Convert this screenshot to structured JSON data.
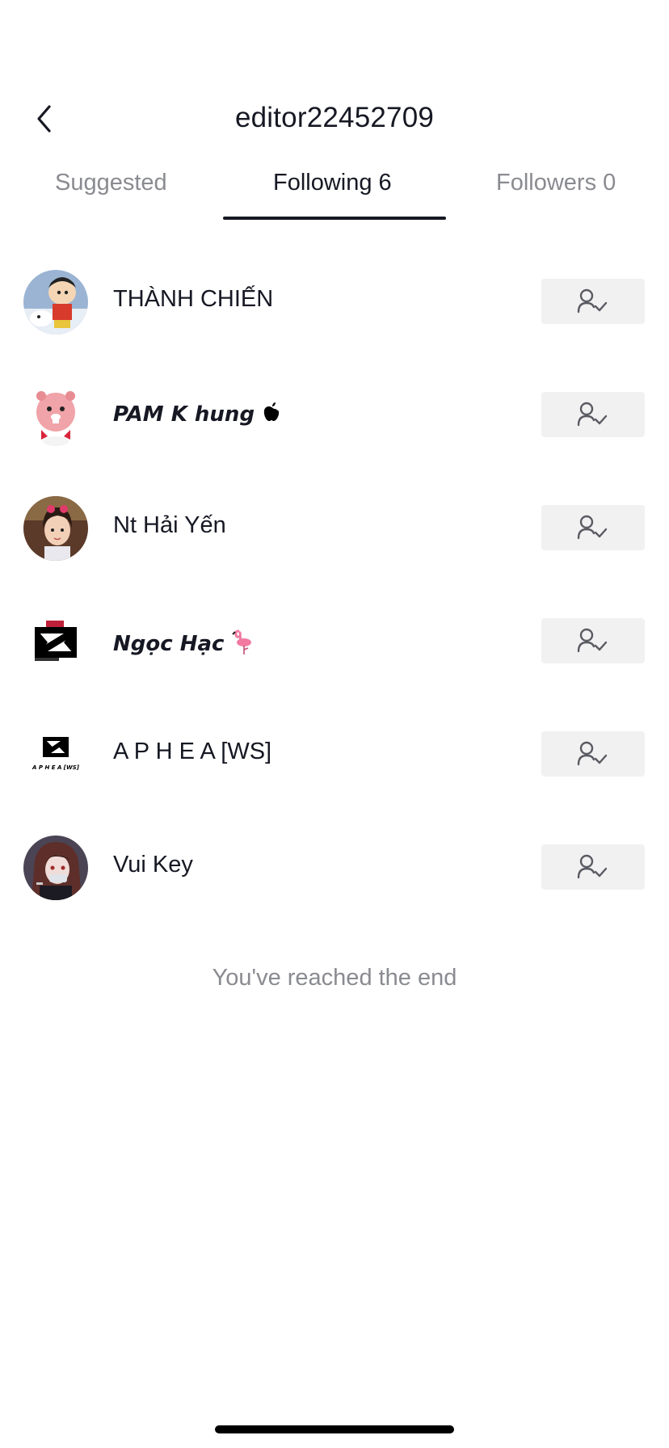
{
  "header": {
    "title": "editor22452709",
    "back_icon": "chevron-left-icon"
  },
  "tabs": [
    {
      "label": "Suggested",
      "active": false
    },
    {
      "label": "Following 6",
      "active": true
    },
    {
      "label": "Followers 0",
      "active": false
    }
  ],
  "following": [
    {
      "name": "THÀNH CHIẾN",
      "avatar": "cartoon-boy-avatar",
      "status_icon": "following-user-check-icon"
    },
    {
      "name": "PAM K hung",
      "badge_icon": "apple-icon",
      "avatar": "pink-beaver-avatar",
      "status_icon": "following-user-check-icon"
    },
    {
      "name": "Nt Hải Yến",
      "avatar": "girl-photo-avatar",
      "status_icon": "following-user-check-icon"
    },
    {
      "name": "Ngọc Hạc",
      "badge_icon": "flamingo-icon",
      "avatar": "capcut-logo-avatar",
      "status_icon": "following-user-check-icon"
    },
    {
      "name": "A P H E A [WS]",
      "avatar": "capcut-logo-avatar",
      "avatar_caption": "A P H E A [WS]",
      "status_icon": "following-user-check-icon"
    },
    {
      "name": "Vui Key",
      "avatar": "anime-character-avatar",
      "status_icon": "following-user-check-icon"
    }
  ],
  "end_message": "You've reached the end",
  "colors": {
    "text_primary": "#161823",
    "text_secondary": "#8a8b91",
    "button_bg": "#f1f1f2"
  }
}
